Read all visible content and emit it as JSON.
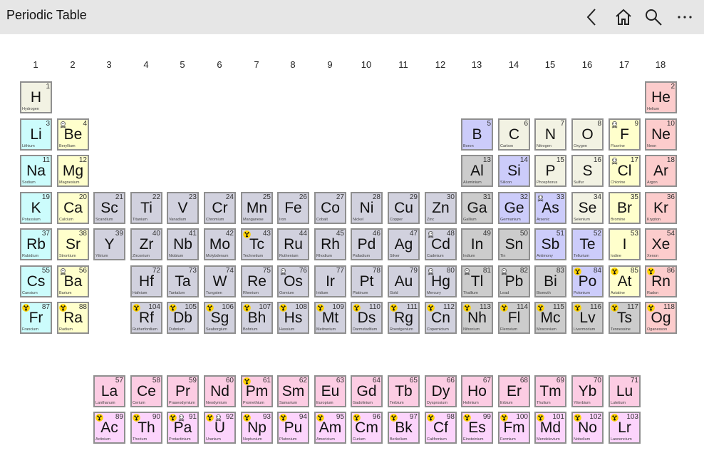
{
  "app": {
    "title": "Periodic Table"
  },
  "toolbar": {
    "back_icon": "chevron-left-icon",
    "home_icon": "home-icon",
    "search_icon": "search-icon",
    "more_icon": "more-icon"
  },
  "group_numbers": [
    "1",
    "2",
    "3",
    "4",
    "5",
    "6",
    "7",
    "8",
    "9",
    "10",
    "11",
    "12",
    "13",
    "14",
    "15",
    "16",
    "17",
    "18"
  ],
  "category_colors": {
    "other": "#f2f2e3",
    "alkali": "#ccfcfc",
    "alkaline": "#ffffcc",
    "transition": "#d1d1de",
    "post": "#cccccc",
    "metalloid": "#ccccfa",
    "halogen": "#ffffcc",
    "noble": "#fccccc",
    "lanth": "#fccce3",
    "act": "#fcd4fc"
  },
  "elements": [
    {
      "n": 1,
      "s": "H",
      "name": "Hydrogen",
      "c": "other"
    },
    {
      "n": 2,
      "s": "He",
      "name": "Helium",
      "c": "noble"
    },
    {
      "n": 3,
      "s": "Li",
      "name": "Lithium",
      "c": "alkali"
    },
    {
      "n": 4,
      "s": "Be",
      "name": "Beryllium",
      "c": "alkaline",
      "tox": true
    },
    {
      "n": 5,
      "s": "B",
      "name": "Boron",
      "c": "metalloid"
    },
    {
      "n": 6,
      "s": "C",
      "name": "Carbon",
      "c": "other"
    },
    {
      "n": 7,
      "s": "N",
      "name": "Nitrogen",
      "c": "other"
    },
    {
      "n": 8,
      "s": "O",
      "name": "Oxygen",
      "c": "other"
    },
    {
      "n": 9,
      "s": "F",
      "name": "Fluorine",
      "c": "halogen",
      "tox": true
    },
    {
      "n": 10,
      "s": "Ne",
      "name": "Neon",
      "c": "noble"
    },
    {
      "n": 11,
      "s": "Na",
      "name": "Sodium",
      "c": "alkali"
    },
    {
      "n": 12,
      "s": "Mg",
      "name": "Magnesium",
      "c": "alkaline"
    },
    {
      "n": 13,
      "s": "Al",
      "name": "Aluminium",
      "c": "post"
    },
    {
      "n": 14,
      "s": "Si",
      "name": "Silicon",
      "c": "metalloid"
    },
    {
      "n": 15,
      "s": "P",
      "name": "Phosphorus",
      "c": "other"
    },
    {
      "n": 16,
      "s": "S",
      "name": "Sulfur",
      "c": "other"
    },
    {
      "n": 17,
      "s": "Cl",
      "name": "Chlorine",
      "c": "halogen",
      "tox": true
    },
    {
      "n": 18,
      "s": "Ar",
      "name": "Argon",
      "c": "noble"
    },
    {
      "n": 19,
      "s": "K",
      "name": "Potassium",
      "c": "alkali"
    },
    {
      "n": 20,
      "s": "Ca",
      "name": "Calcium",
      "c": "alkaline"
    },
    {
      "n": 21,
      "s": "Sc",
      "name": "Scandium",
      "c": "transition"
    },
    {
      "n": 22,
      "s": "Ti",
      "name": "Titanium",
      "c": "transition"
    },
    {
      "n": 23,
      "s": "V",
      "name": "Vanadium",
      "c": "transition"
    },
    {
      "n": 24,
      "s": "Cr",
      "name": "Chromium",
      "c": "transition"
    },
    {
      "n": 25,
      "s": "Mn",
      "name": "Manganese",
      "c": "transition"
    },
    {
      "n": 26,
      "s": "Fe",
      "name": "Iron",
      "c": "transition"
    },
    {
      "n": 27,
      "s": "Co",
      "name": "Cobalt",
      "c": "transition"
    },
    {
      "n": 28,
      "s": "Ni",
      "name": "Nickel",
      "c": "transition"
    },
    {
      "n": 29,
      "s": "Cu",
      "name": "Copper",
      "c": "transition"
    },
    {
      "n": 30,
      "s": "Zn",
      "name": "Zinc",
      "c": "transition"
    },
    {
      "n": 31,
      "s": "Ga",
      "name": "Gallium",
      "c": "post"
    },
    {
      "n": 32,
      "s": "Ge",
      "name": "Germanium",
      "c": "metalloid"
    },
    {
      "n": 33,
      "s": "As",
      "name": "Arsenic",
      "c": "metalloid",
      "tox": true
    },
    {
      "n": 34,
      "s": "Se",
      "name": "Selenium",
      "c": "other"
    },
    {
      "n": 35,
      "s": "Br",
      "name": "Bromine",
      "c": "halogen"
    },
    {
      "n": 36,
      "s": "Kr",
      "name": "Krypton",
      "c": "noble"
    },
    {
      "n": 37,
      "s": "Rb",
      "name": "Rubidium",
      "c": "alkali"
    },
    {
      "n": 38,
      "s": "Sr",
      "name": "Strontium",
      "c": "alkaline"
    },
    {
      "n": 39,
      "s": "Y",
      "name": "Yttrium",
      "c": "transition"
    },
    {
      "n": 40,
      "s": "Zr",
      "name": "Zirconium",
      "c": "transition"
    },
    {
      "n": 41,
      "s": "Nb",
      "name": "Niobium",
      "c": "transition"
    },
    {
      "n": 42,
      "s": "Mo",
      "name": "Molybdenum",
      "c": "transition"
    },
    {
      "n": 43,
      "s": "Tc",
      "name": "Technetium",
      "c": "transition",
      "rad": true
    },
    {
      "n": 44,
      "s": "Ru",
      "name": "Ruthenium",
      "c": "transition"
    },
    {
      "n": 45,
      "s": "Rh",
      "name": "Rhodium",
      "c": "transition"
    },
    {
      "n": 46,
      "s": "Pd",
      "name": "Palladium",
      "c": "transition"
    },
    {
      "n": 47,
      "s": "Ag",
      "name": "Silver",
      "c": "transition"
    },
    {
      "n": 48,
      "s": "Cd",
      "name": "Cadmium",
      "c": "transition",
      "tox": true
    },
    {
      "n": 49,
      "s": "In",
      "name": "Indium",
      "c": "post"
    },
    {
      "n": 50,
      "s": "Sn",
      "name": "Tin",
      "c": "post"
    },
    {
      "n": 51,
      "s": "Sb",
      "name": "Antimony",
      "c": "metalloid"
    },
    {
      "n": 52,
      "s": "Te",
      "name": "Tellurium",
      "c": "metalloid"
    },
    {
      "n": 53,
      "s": "I",
      "name": "Iodine",
      "c": "halogen"
    },
    {
      "n": 54,
      "s": "Xe",
      "name": "Xenon",
      "c": "noble"
    },
    {
      "n": 55,
      "s": "Cs",
      "name": "Caesium",
      "c": "alkali"
    },
    {
      "n": 56,
      "s": "Ba",
      "name": "Barium",
      "c": "alkaline",
      "tox": true
    },
    {
      "n": 72,
      "s": "Hf",
      "name": "Hafnium",
      "c": "transition"
    },
    {
      "n": 73,
      "s": "Ta",
      "name": "Tantalum",
      "c": "transition"
    },
    {
      "n": 74,
      "s": "W",
      "name": "Tungsten",
      "c": "transition"
    },
    {
      "n": 75,
      "s": "Re",
      "name": "Rhenium",
      "c": "transition"
    },
    {
      "n": 76,
      "s": "Os",
      "name": "Osmium",
      "c": "transition",
      "tox": true
    },
    {
      "n": 77,
      "s": "Ir",
      "name": "Iridium",
      "c": "transition"
    },
    {
      "n": 78,
      "s": "Pt",
      "name": "Platinum",
      "c": "transition"
    },
    {
      "n": 79,
      "s": "Au",
      "name": "Gold",
      "c": "transition"
    },
    {
      "n": 80,
      "s": "Hg",
      "name": "Mercury",
      "c": "transition",
      "tox": true
    },
    {
      "n": 81,
      "s": "Tl",
      "name": "Thallium",
      "c": "post",
      "tox": true
    },
    {
      "n": 82,
      "s": "Pb",
      "name": "Lead",
      "c": "post",
      "tox": true
    },
    {
      "n": 83,
      "s": "Bi",
      "name": "Bismuth",
      "c": "post"
    },
    {
      "n": 84,
      "s": "Po",
      "name": "Polonium",
      "c": "metalloid",
      "rad": true
    },
    {
      "n": 85,
      "s": "At",
      "name": "Astatine",
      "c": "halogen",
      "rad": true
    },
    {
      "n": 86,
      "s": "Rn",
      "name": "Radon",
      "c": "noble",
      "rad": true
    },
    {
      "n": 87,
      "s": "Fr",
      "name": "Francium",
      "c": "alkali",
      "rad": true
    },
    {
      "n": 88,
      "s": "Ra",
      "name": "Radium",
      "c": "alkaline",
      "rad": true
    },
    {
      "n": 104,
      "s": "Rf",
      "name": "Rutherfordium",
      "c": "transition",
      "rad": true
    },
    {
      "n": 105,
      "s": "Db",
      "name": "Dubnium",
      "c": "transition",
      "rad": true
    },
    {
      "n": 106,
      "s": "Sg",
      "name": "Seaborgium",
      "c": "transition",
      "rad": true
    },
    {
      "n": 107,
      "s": "Bh",
      "name": "Bohrium",
      "c": "transition",
      "rad": true
    },
    {
      "n": 108,
      "s": "Hs",
      "name": "Hassium",
      "c": "transition",
      "rad": true
    },
    {
      "n": 109,
      "s": "Mt",
      "name": "Meitnerium",
      "c": "transition",
      "rad": true
    },
    {
      "n": 110,
      "s": "Ds",
      "name": "Darmstadtium",
      "c": "transition",
      "rad": true
    },
    {
      "n": 111,
      "s": "Rg",
      "name": "Roentgenium",
      "c": "transition",
      "rad": true
    },
    {
      "n": 112,
      "s": "Cn",
      "name": "Copernicium",
      "c": "transition",
      "rad": true
    },
    {
      "n": 113,
      "s": "Nh",
      "name": "Nihonium",
      "c": "post",
      "rad": true
    },
    {
      "n": 114,
      "s": "Fl",
      "name": "Flerovium",
      "c": "post",
      "rad": true
    },
    {
      "n": 115,
      "s": "Mc",
      "name": "Moscovium",
      "c": "post",
      "rad": true
    },
    {
      "n": 116,
      "s": "Lv",
      "name": "Livermorium",
      "c": "post",
      "rad": true
    },
    {
      "n": 117,
      "s": "Ts",
      "name": "Tennessine",
      "c": "post",
      "rad": true
    },
    {
      "n": 118,
      "s": "Og",
      "name": "Oganesson",
      "c": "noble",
      "rad": true
    },
    {
      "n": 57,
      "s": "La",
      "name": "Lanthanum",
      "c": "lanth"
    },
    {
      "n": 58,
      "s": "Ce",
      "name": "Cerium",
      "c": "lanth"
    },
    {
      "n": 59,
      "s": "Pr",
      "name": "Praseodymium",
      "c": "lanth"
    },
    {
      "n": 60,
      "s": "Nd",
      "name": "Neodymium",
      "c": "lanth"
    },
    {
      "n": 61,
      "s": "Pm",
      "name": "Promethium",
      "c": "lanth",
      "rad": true
    },
    {
      "n": 62,
      "s": "Sm",
      "name": "Samarium",
      "c": "lanth"
    },
    {
      "n": 63,
      "s": "Eu",
      "name": "Europium",
      "c": "lanth"
    },
    {
      "n": 64,
      "s": "Gd",
      "name": "Gadolinium",
      "c": "lanth"
    },
    {
      "n": 65,
      "s": "Tb",
      "name": "Terbium",
      "c": "lanth"
    },
    {
      "n": 66,
      "s": "Dy",
      "name": "Dysprosium",
      "c": "lanth"
    },
    {
      "n": 67,
      "s": "Ho",
      "name": "Holmium",
      "c": "lanth"
    },
    {
      "n": 68,
      "s": "Er",
      "name": "Erbium",
      "c": "lanth"
    },
    {
      "n": 69,
      "s": "Tm",
      "name": "Thulium",
      "c": "lanth"
    },
    {
      "n": 70,
      "s": "Yb",
      "name": "Ytterbium",
      "c": "lanth"
    },
    {
      "n": 71,
      "s": "Lu",
      "name": "Lutetium",
      "c": "lanth"
    },
    {
      "n": 89,
      "s": "Ac",
      "name": "Actinium",
      "c": "act",
      "rad": true
    },
    {
      "n": 90,
      "s": "Th",
      "name": "Thorium",
      "c": "act",
      "rad": true
    },
    {
      "n": 91,
      "s": "Pa",
      "name": "Protactinium",
      "c": "act",
      "rad": true,
      "tox": true
    },
    {
      "n": 92,
      "s": "U",
      "name": "Uranium",
      "c": "act",
      "rad": true,
      "tox": true
    },
    {
      "n": 93,
      "s": "Np",
      "name": "Neptunium",
      "c": "act",
      "rad": true
    },
    {
      "n": 94,
      "s": "Pu",
      "name": "Plutonium",
      "c": "act",
      "rad": true
    },
    {
      "n": 95,
      "s": "Am",
      "name": "Americium",
      "c": "act",
      "rad": true
    },
    {
      "n": 96,
      "s": "Cm",
      "name": "Curium",
      "c": "act",
      "rad": true
    },
    {
      "n": 97,
      "s": "Bk",
      "name": "Berkelium",
      "c": "act",
      "rad": true
    },
    {
      "n": 98,
      "s": "Cf",
      "name": "Californium",
      "c": "act",
      "rad": true
    },
    {
      "n": 99,
      "s": "Es",
      "name": "Einsteinium",
      "c": "act",
      "rad": true
    },
    {
      "n": 100,
      "s": "Fm",
      "name": "Fermium",
      "c": "act",
      "rad": true
    },
    {
      "n": 101,
      "s": "Md",
      "name": "Mendelevium",
      "c": "act",
      "rad": true
    },
    {
      "n": 102,
      "s": "No",
      "name": "Nobelium",
      "c": "act",
      "rad": true
    },
    {
      "n": 103,
      "s": "Lr",
      "name": "Lawrencium",
      "c": "act",
      "rad": true
    }
  ]
}
